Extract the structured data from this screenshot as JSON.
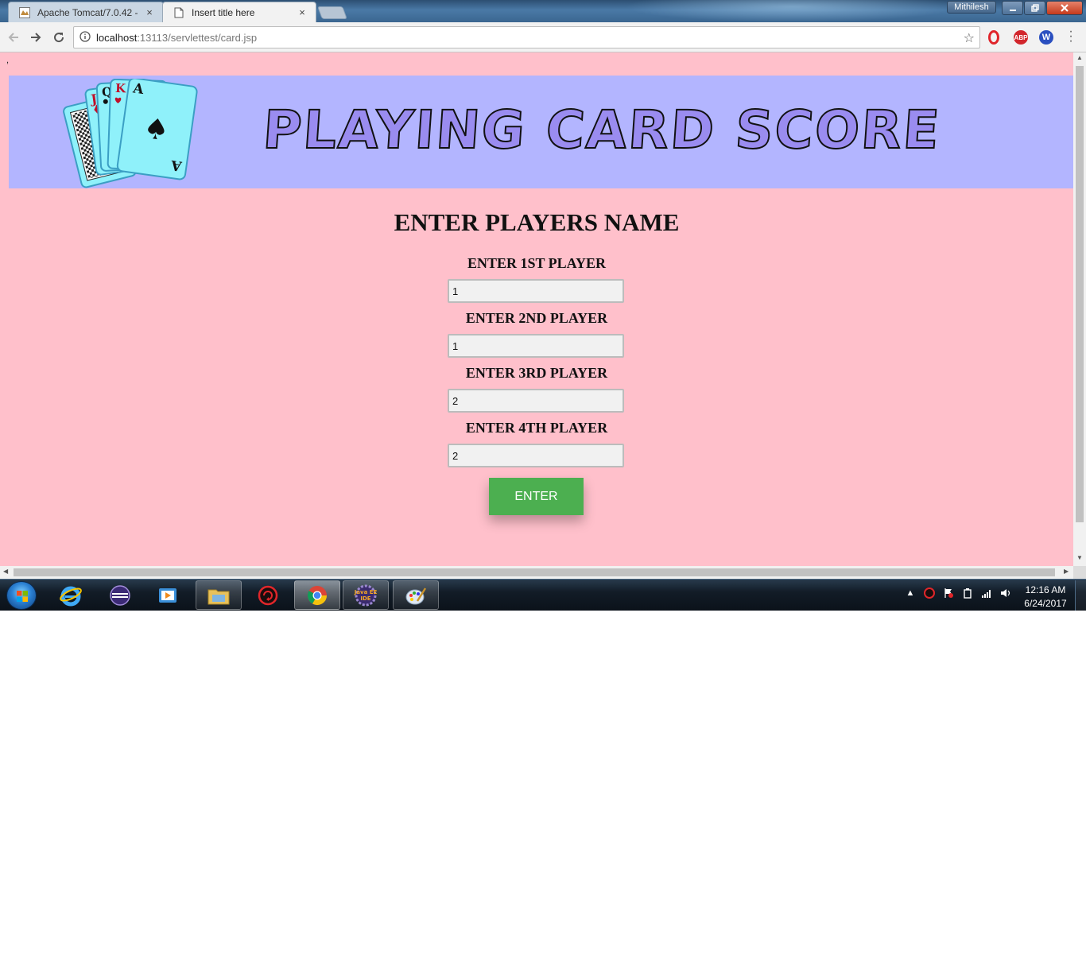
{
  "browser": {
    "tabs": [
      {
        "label": "Apache Tomcat/7.0.42 - ",
        "close": "×"
      },
      {
        "label": "Insert title here",
        "close": "×"
      }
    ],
    "profile_name": "Mithilesh",
    "address": {
      "host": "localhost",
      "rest": ":13113/servlettest/card.jsp"
    },
    "extensions": {
      "abp_label": "ABP",
      "w_label": "W"
    }
  },
  "page": {
    "stray_char": ",",
    "banner_title": "PLAYING CARD SCORE",
    "heading": "ENTER PLAYERS NAME",
    "players": [
      {
        "label": "ENTER 1ST PLAYER",
        "value": "1"
      },
      {
        "label": "ENTER 2ND PLAYER",
        "value": "1"
      },
      {
        "label": "ENTER 3RD PLAYER",
        "value": "2"
      },
      {
        "label": "ENTER 4TH PLAYER",
        "value": "2"
      }
    ],
    "submit_label": "ENTER",
    "colors": {
      "page_bg": "#ffc0cb",
      "banner_bg": "#b3b5ff",
      "button_bg": "#4caf50"
    }
  },
  "taskbar": {
    "clock_time": "12:16 AM",
    "clock_date": "6/24/2017",
    "apps": [
      "internet-explorer-icon",
      "eclipse-icon",
      "media-player-icon",
      "file-explorer-icon",
      "recovery-tool-icon",
      "chrome-icon",
      "java-ee-ide-icon",
      "paint-icon"
    ],
    "java_ide_label": "Java EE IDE"
  }
}
